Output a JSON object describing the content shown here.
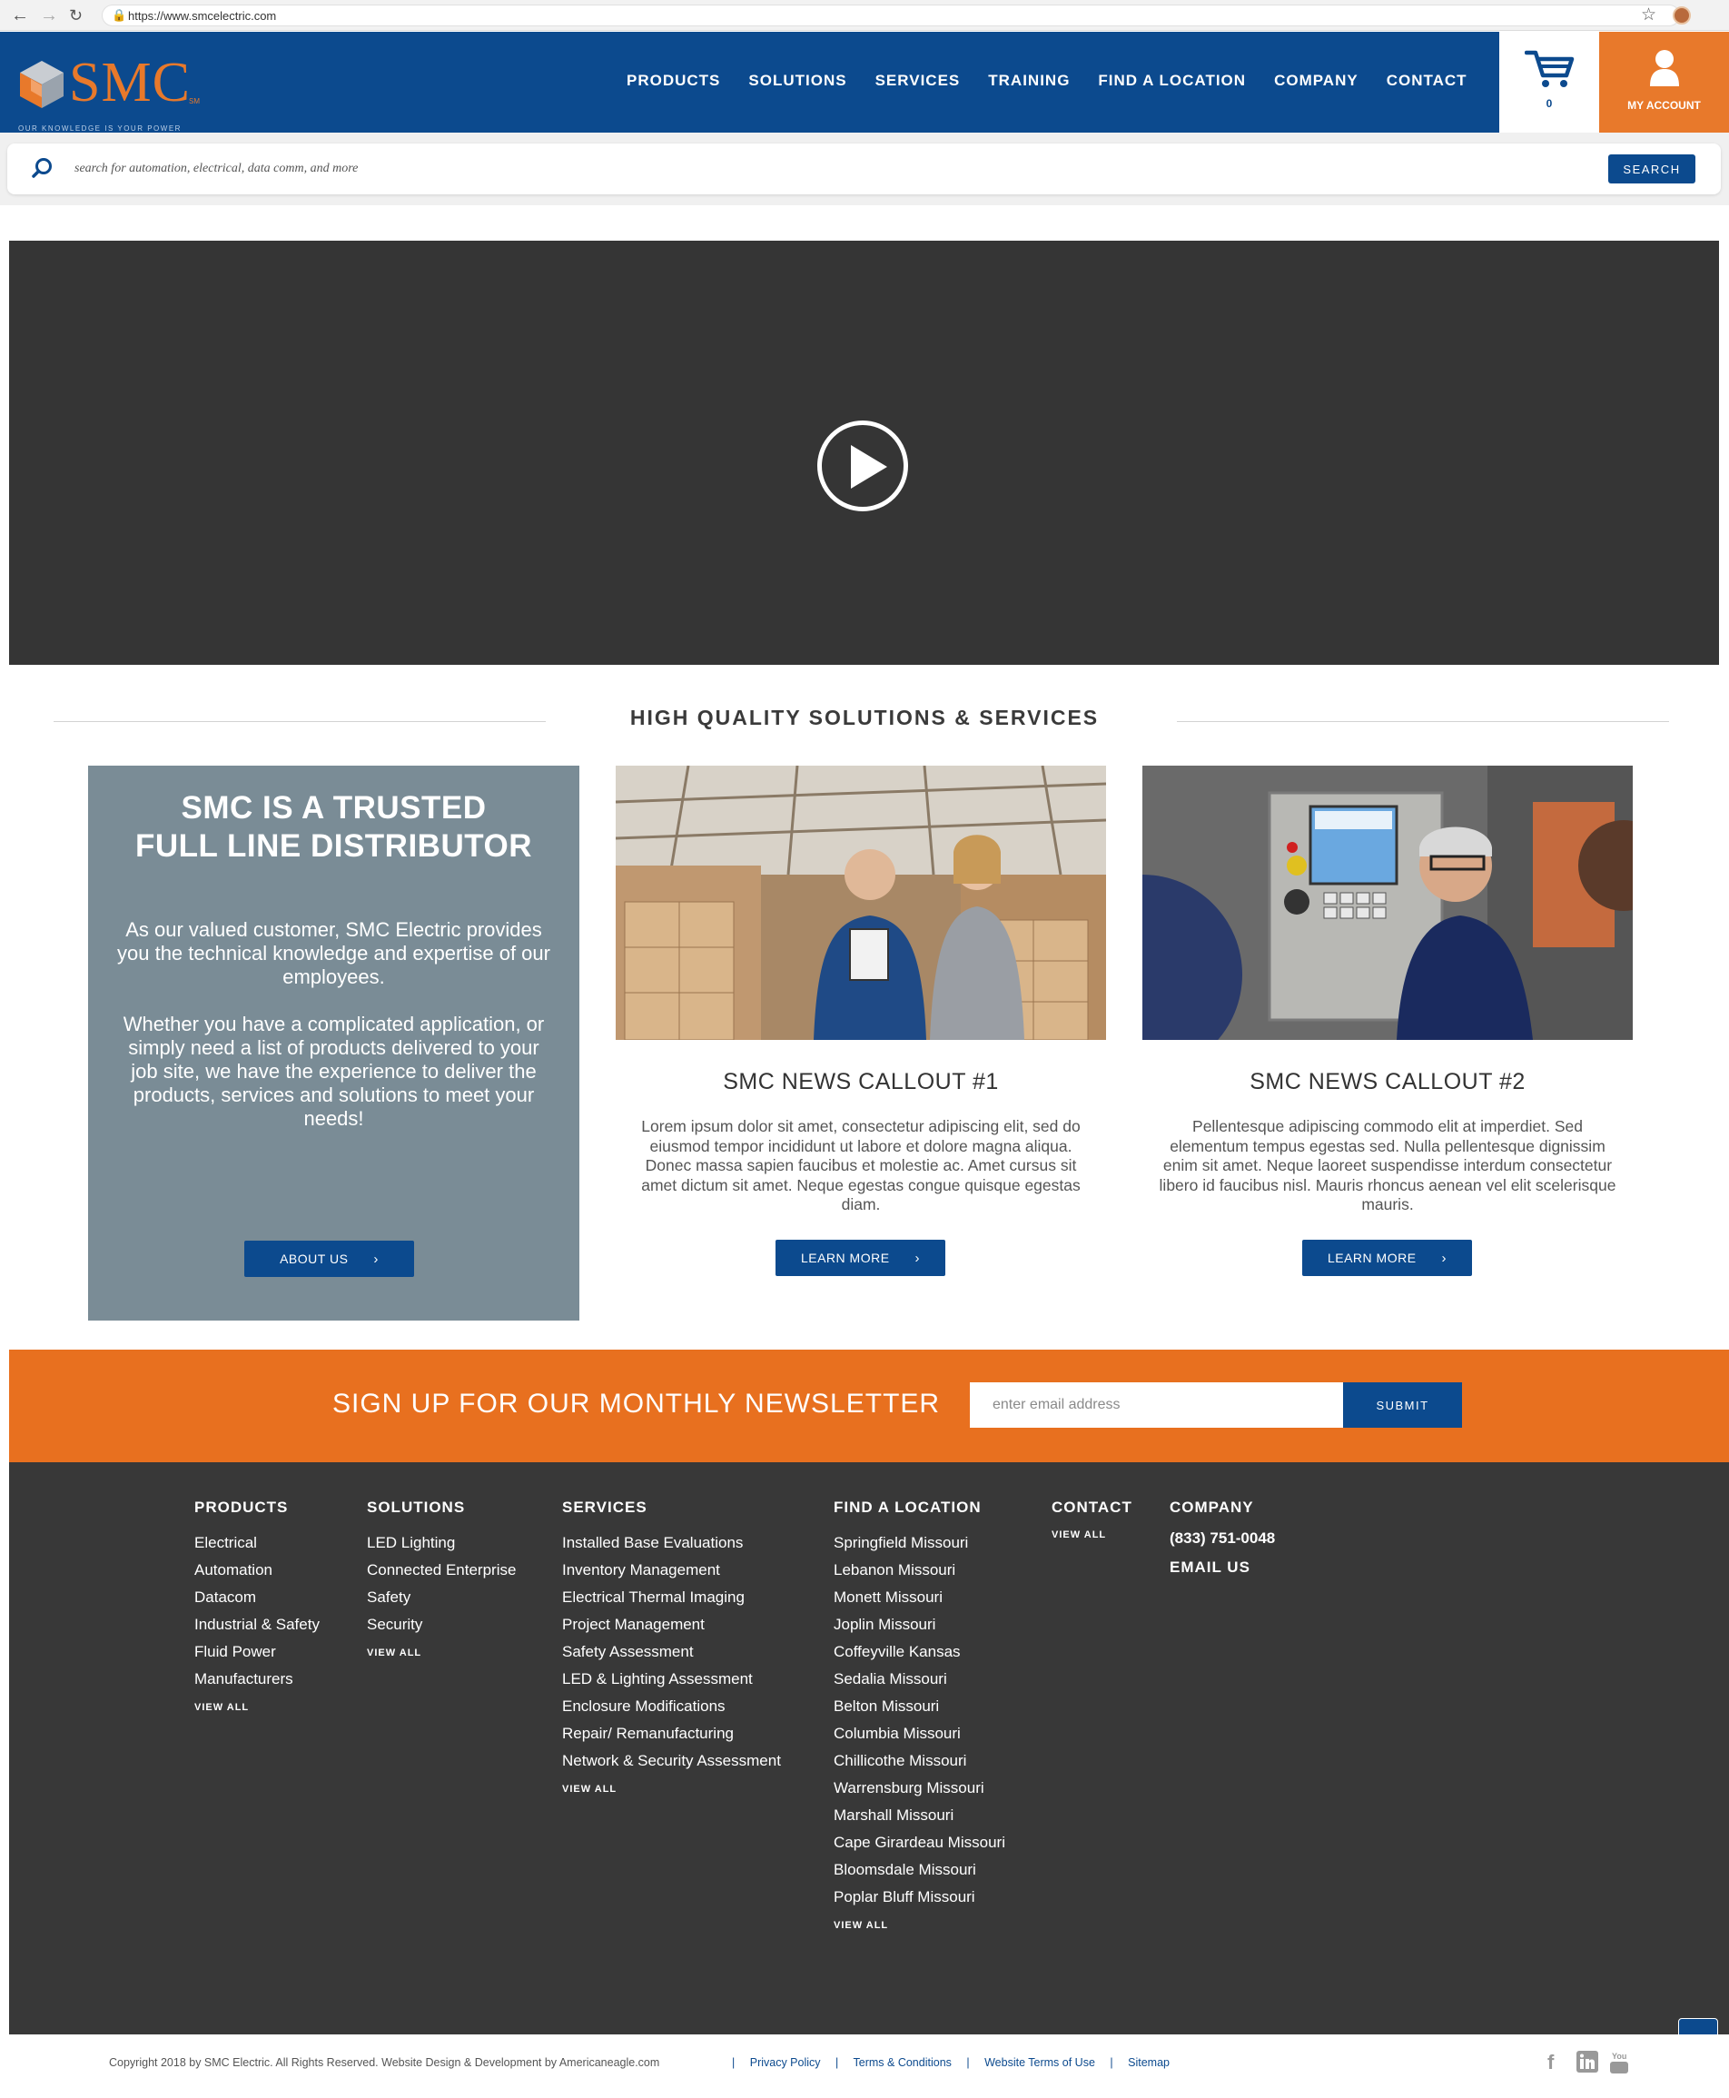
{
  "browser": {
    "url": "https://www.smcelectric.com"
  },
  "header": {
    "logo_text": "SMC",
    "logo_sm": "SM",
    "tagline": "OUR KNOWLEDGE IS YOUR POWER",
    "nav": [
      "PRODUCTS",
      "SOLUTIONS",
      "SERVICES",
      "TRAINING",
      "FIND A LOCATION",
      "COMPANY",
      "CONTACT"
    ],
    "cart_count": "0",
    "account_label": "MY ACCOUNT",
    "colors": {
      "primary": "#0c4a8e",
      "accent": "#e8792b"
    }
  },
  "search": {
    "placeholder": "search for automation, electrical, data comm, and more",
    "button_label": "SEARCH"
  },
  "video": {
    "icon": "play-icon"
  },
  "section": {
    "heading": "HIGH QUALITY SOLUTIONS & SERVICES"
  },
  "trusted": {
    "title_line1": "SMC IS A TRUSTED",
    "title_line2": "FULL LINE DISTRIBUTOR",
    "para1": "As our valued customer, SMC Electric provides you the technical knowledge and expertise of our employees.",
    "para2": "Whether you have a complicated application, or simply need a list of products delivered to your job site, we have the experience to deliver the products, services and solutions to meet your needs!",
    "button_label": "ABOUT US"
  },
  "news": [
    {
      "title": "SMC NEWS CALLOUT #1",
      "body": "Lorem ipsum dolor sit amet, consectetur adipiscing elit, sed do eiusmod tempor incididunt ut labore et dolore magna aliqua. Donec massa sapien faucibus et molestie ac. Amet cursus sit amet dictum sit amet. Neque egestas congue quisque egestas diam.",
      "button_label": "LEARN MORE"
    },
    {
      "title": "SMC NEWS CALLOUT #2",
      "body": "Pellentesque adipiscing commodo elit at imperdiet. Sed elementum tempus egestas sed. Nulla pellentesque dignissim enim sit amet. Neque laoreet suspendisse interdum consectetur libero id faucibus nisl. Mauris rhoncus aenean vel elit scelerisque mauris.",
      "button_label": "LEARN MORE"
    }
  ],
  "newsletter": {
    "heading": "SIGN UP FOR OUR MONTHLY NEWSLETTER",
    "placeholder": "enter email address",
    "button_label": "SUBMIT"
  },
  "footer": {
    "products": {
      "heading": "PRODUCTS",
      "items": [
        "Electrical",
        "Automation",
        "Datacom",
        "Industrial & Safety",
        "Fluid Power",
        "Manufacturers"
      ],
      "view_all": "VIEW ALL"
    },
    "solutions": {
      "heading": "SOLUTIONS",
      "items": [
        "LED Lighting",
        "Connected Enterprise",
        "Safety",
        "Security"
      ],
      "view_all": "VIEW ALL"
    },
    "services": {
      "heading": "SERVICES",
      "items": [
        "Installed Base Evaluations",
        "Inventory Management",
        "Electrical Thermal Imaging",
        "Project Management",
        "Safety Assessment",
        "LED & Lighting Assessment",
        "Enclosure Modifications",
        "Repair/ Remanufacturing",
        "Network & Security Assessment"
      ],
      "view_all": "VIEW ALL"
    },
    "locations": {
      "heading": "FIND A LOCATION",
      "items": [
        "Springfield Missouri",
        "Lebanon Missouri",
        "Monett Missouri",
        "Joplin Missouri",
        "Coffeyville Kansas",
        "Sedalia Missouri",
        "Belton Missouri",
        "Columbia Missouri",
        "Chillicothe Missouri",
        "Warrensburg Missouri",
        "Marshall Missouri",
        "Cape Girardeau Missouri",
        "Bloomsdale Missouri",
        "Poplar Bluff Missouri"
      ],
      "view_all": "VIEW ALL"
    },
    "contact": {
      "heading": "CONTACT",
      "view_all": "VIEW ALL"
    },
    "company": {
      "heading": "COMPANY",
      "phone": "(833) 751-0048",
      "email": "EMAIL US"
    }
  },
  "bottom": {
    "copyright": "Copyright 2018 by SMC Electric. All Rights Reserved. Website Design & Development by Americaneagle.com",
    "links": [
      "Privacy Policy",
      "Terms & Conditions",
      "Website Terms of Use",
      "Sitemap"
    ],
    "social": [
      "facebook-icon",
      "linkedin-icon",
      "youtube-icon"
    ]
  }
}
